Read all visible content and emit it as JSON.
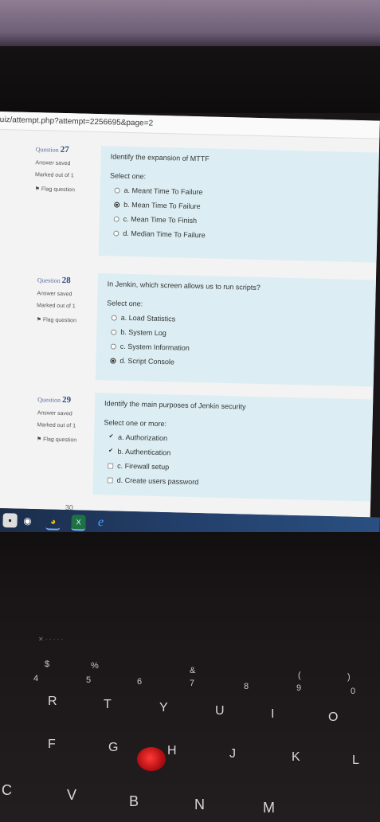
{
  "browser": {
    "url": "uiz/attempt.php?attempt=2256695&page=2"
  },
  "questions": [
    {
      "label": "Question",
      "number": "27",
      "status": "Answer saved",
      "marks": "Marked out of 1",
      "flag": "Flag question",
      "text": "Identify the expansion of MTTF",
      "select_label": "Select one:",
      "type": "radio",
      "options": [
        {
          "label": "a. Meant Time To Failure",
          "selected": false
        },
        {
          "label": "b. Mean Time To Failure",
          "selected": true
        },
        {
          "label": "c. Mean Time To Finish",
          "selected": false
        },
        {
          "label": "d. Median Time To Failure",
          "selected": false
        }
      ]
    },
    {
      "label": "Question",
      "number": "28",
      "status": "Answer saved",
      "marks": "Marked out of 1",
      "flag": "Flag question",
      "text": "In Jenkin, which screen allows us to run scripts?",
      "select_label": "Select one:",
      "type": "radio",
      "options": [
        {
          "label": "a. Load Statistics",
          "selected": false
        },
        {
          "label": "b. System Log",
          "selected": false
        },
        {
          "label": "c. System Information",
          "selected": false
        },
        {
          "label": "d. Script Console",
          "selected": true
        }
      ]
    },
    {
      "label": "Question",
      "number": "29",
      "status": "Answer saved",
      "marks": "Marked out of 1",
      "flag": "Flag question",
      "text": "Identify the main purposes of Jenkin security",
      "select_label": "Select one or more:",
      "type": "checkbox",
      "options": [
        {
          "label": "a. Authorization",
          "selected": true
        },
        {
          "label": "b. Authentication",
          "selected": true
        },
        {
          "label": "c. Firewall setup",
          "selected": false
        },
        {
          "label": "d. Create users password",
          "selected": false
        }
      ]
    }
  ],
  "next_question_partial": "30",
  "taskbar": {
    "icons": [
      "start-icon",
      "edge-chromium-icon",
      "chrome-icon",
      "excel-icon",
      "internet-explorer-icon"
    ]
  },
  "keyboard": {
    "row_numbers": [
      "4",
      "5",
      "6",
      "7",
      "8",
      "9",
      "0"
    ],
    "row_symbols": [
      "$",
      "%",
      "&",
      "(",
      ")"
    ],
    "row_top": [
      "R",
      "T",
      "Y",
      "U",
      "I",
      "O"
    ],
    "row_mid": [
      "F",
      "G",
      "H",
      "J",
      "K",
      "L"
    ],
    "row_bottom": [
      "C",
      "V",
      "B",
      "N",
      "M"
    ]
  }
}
